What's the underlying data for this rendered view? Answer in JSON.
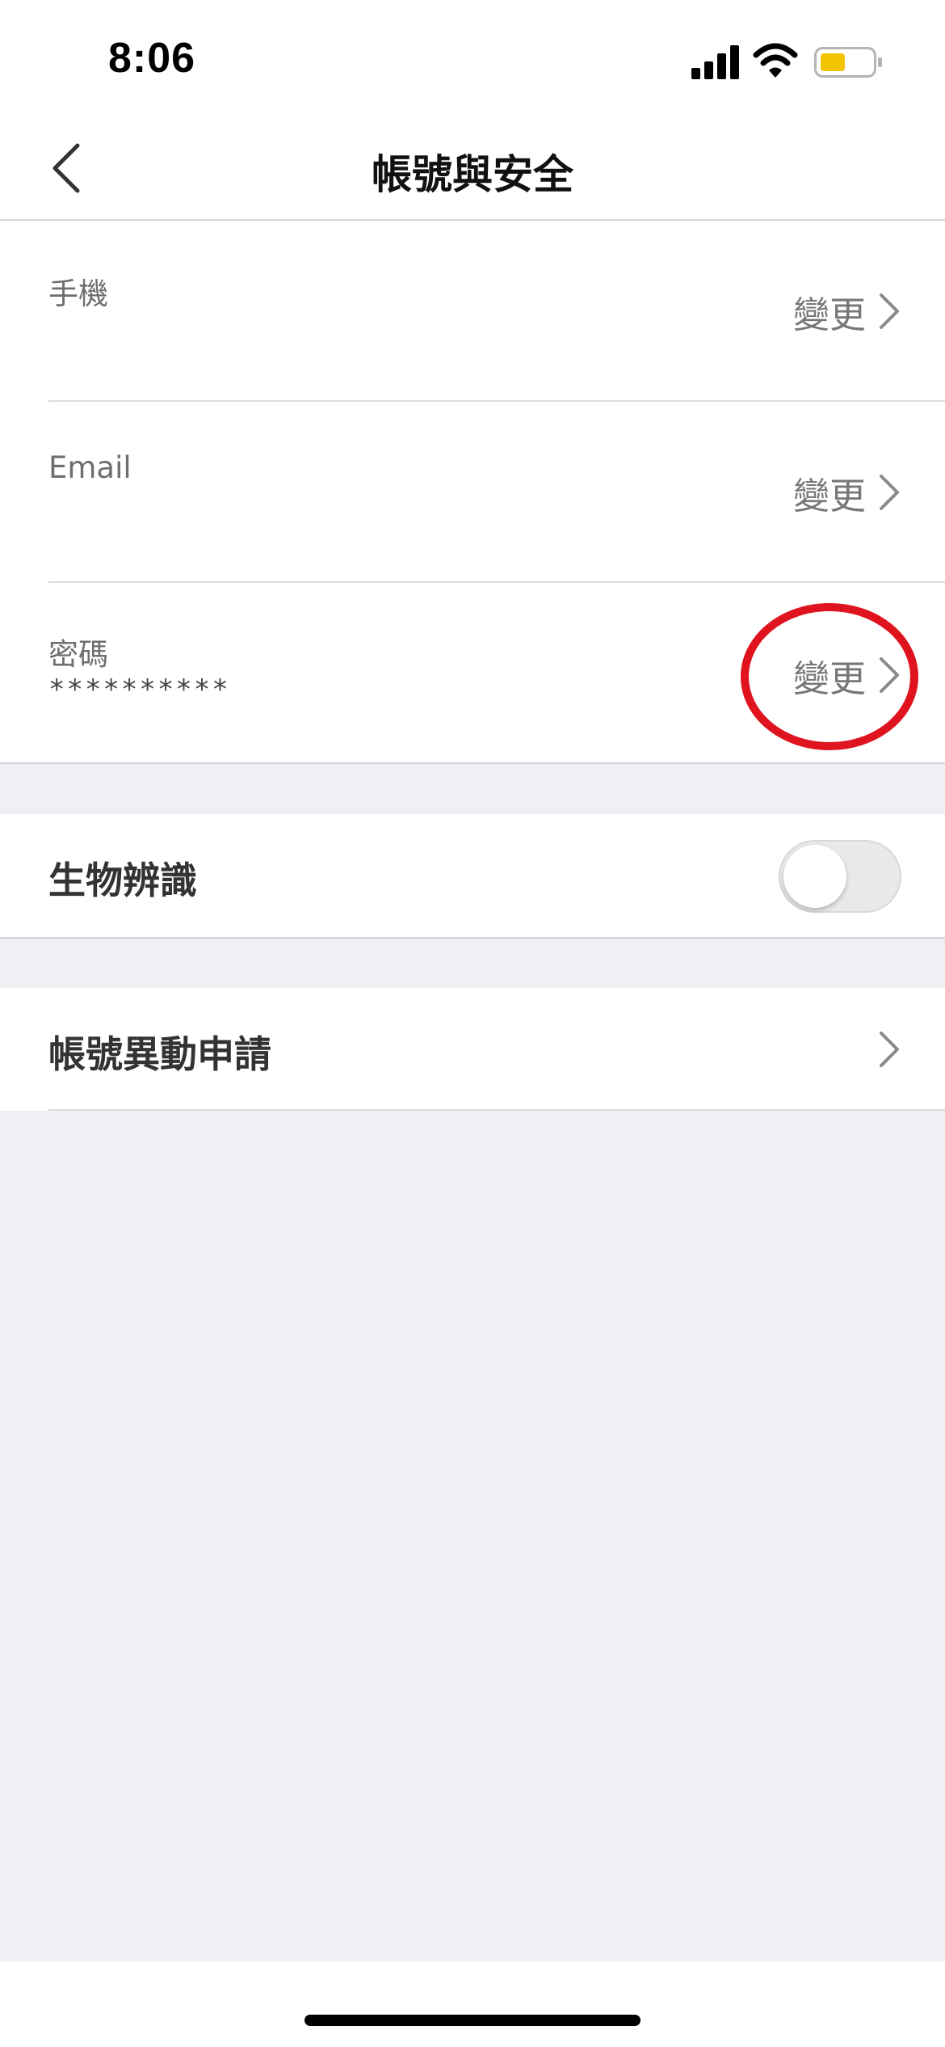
{
  "status_bar": {
    "time": "8:06",
    "battery_color": "#f5c400"
  },
  "nav": {
    "title": "帳號與安全",
    "back_icon": "chevron-left-icon"
  },
  "account_section": {
    "phone": {
      "label": "手機",
      "action": "變更"
    },
    "email": {
      "label": "Email",
      "action": "變更"
    },
    "password": {
      "label": "密碼",
      "masked_value": "**********",
      "action": "變更"
    },
    "highlight_color": "#e0141e"
  },
  "biometric": {
    "label": "生物辨識",
    "enabled": false
  },
  "account_change": {
    "label": "帳號異動申請"
  },
  "colors": {
    "background": "#efeff4",
    "card": "#ffffff",
    "secondary_text": "#777777"
  }
}
